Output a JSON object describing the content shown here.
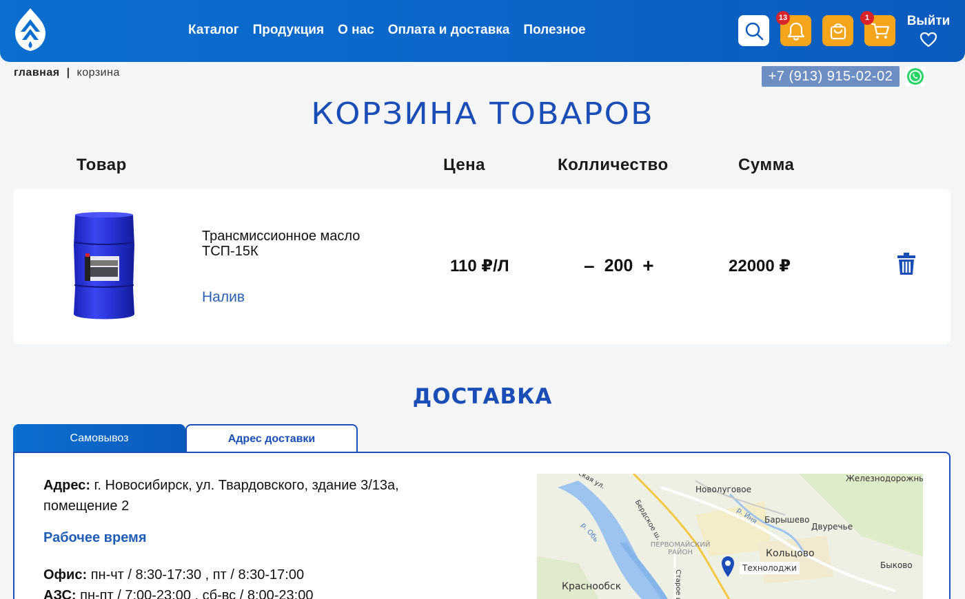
{
  "header": {
    "nav": [
      "Каталог",
      "Продукция",
      "О нас",
      "Оплата и доставка",
      "Полезное"
    ],
    "notifications_count": "13",
    "cart_count": "1",
    "logout_label": "Выйти"
  },
  "breadcrumb": {
    "home": "главная",
    "separator": "|",
    "current": "корзина"
  },
  "contact": {
    "phone": "+7 (913) 915-02-02"
  },
  "page_title": "КОРЗИНА ТОВАРОВ",
  "cart": {
    "columns": {
      "product": "Товар",
      "price": "Цена",
      "quantity": "Колличество",
      "sum": "Сумма"
    },
    "items": [
      {
        "name": "Трансмиссионное масло ТСП-15К",
        "tag": "Налив",
        "price": "110 ₽/Л",
        "minus": "–",
        "qty": "200",
        "plus": "+",
        "sum": "22000 ₽"
      }
    ]
  },
  "delivery": {
    "title": "ДОСТАВКА",
    "tabs": [
      "Самовывоз",
      "Адрес доставки"
    ],
    "address_label": "Адрес:",
    "address_value": " г. Новосибирск, ул. Твардовского, здание 3/13а, помещение 2",
    "hours_title": "Рабочее время",
    "office_label": "Офис:",
    "office_value": " пн-чт / 8:30-17:30 , пт / 8:30-17:00",
    "azs_label": "АЗС:",
    "azs_value": " пн-пт / 7:00-23:00 , сб-вс / 8:00-23:00"
  },
  "map": {
    "labels": [
      "Железнодорожный",
      "Новолуговое",
      "Барышево",
      "Двуречье",
      "Первомайский район",
      "Кольцово",
      "Технолоджи",
      "Быково",
      "Краснообск",
      "р. Обь",
      "р. Иня",
      "Бердское ш.",
      "ская ул.",
      "Старое ш."
    ]
  },
  "colors": {
    "brand_blue": "#0b6fcf",
    "title_blue": "#1a4db5",
    "accent_orange": "#f4a51c",
    "badge_red": "#d8232a"
  }
}
